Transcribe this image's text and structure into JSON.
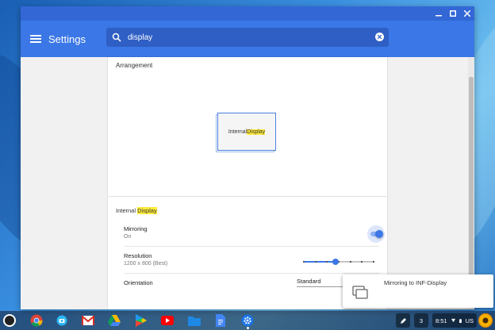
{
  "window": {
    "app_title": "Settings",
    "search_value": "display"
  },
  "arrangement": {
    "section_label": "Arrangement",
    "display_label_prefix": "Internal ",
    "display_label_highlight": "Display"
  },
  "internal_display": {
    "section_prefix": "Internal ",
    "section_highlight": "Display",
    "mirroring": {
      "title": "Mirroring",
      "value": "On",
      "enabled": true
    },
    "resolution": {
      "title": "Resolution",
      "value": "1200 x 800 (Best)",
      "slider_fraction": 0.45,
      "tick_count": 7
    },
    "orientation": {
      "title": "Orientation",
      "selected": "Standard"
    }
  },
  "notification": {
    "text": "Mirroring to INF-Display"
  },
  "shelf": {
    "notification_count": "3",
    "time": "8:51",
    "locale": "US"
  },
  "colors": {
    "accent": "#3b77e6",
    "highlight": "#ffeb3b",
    "titlebar": "#3367d6"
  }
}
